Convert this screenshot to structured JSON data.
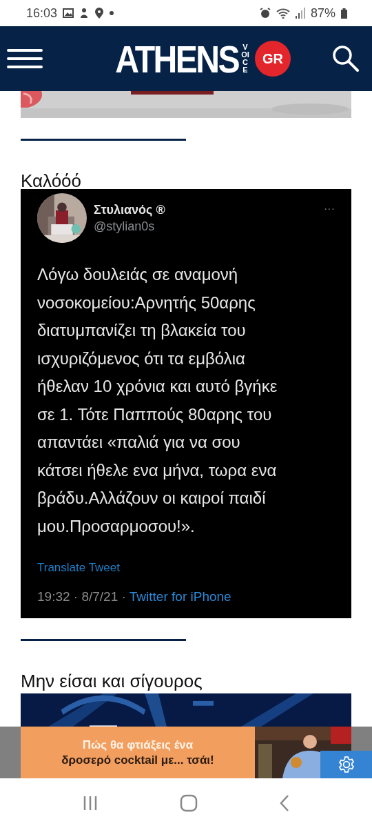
{
  "status_bar": {
    "time": "16:03",
    "battery": "87%"
  },
  "header": {
    "logo": "ATHENS",
    "logo_side": "VOICE",
    "logo_badge": "GR"
  },
  "sections": [
    {
      "heading": "Καλόόό",
      "tweet": {
        "name": "Στυλιανός ®",
        "handle": "@stylian0s",
        "more": "···",
        "text": "Λόγω δουλειάς σε αναμονή\nνοσοκομείου:Αρνητής 50αρης\nδιατυμπανίζει τη βλακεία του\nισχυριζόμενος ότι τα εμβόλια\nήθελαν 10 χρόνια και αυτό βγήκε\nσε 1. Τότε Παππούς 80αρης του\nαπαντάει «παλιά για να σου\nκάτσει ήθελε ενα μήνα, τωρα ενα\nβράδυ.Αλλάζουν οι καιροί παιδί\nμου.Προσαρμοσου!».",
        "translate": "Translate Tweet",
        "meta": "19:32 · 8/7/21 · ",
        "source": "Twitter for iPhone"
      }
    },
    {
      "heading": "Μην είσαι και σίγουρος"
    }
  ],
  "ad": {
    "line_1": "Πώς θα φτιάξεις ένα",
    "line_2": "δροσερό cocktail με... τσάι!"
  }
}
